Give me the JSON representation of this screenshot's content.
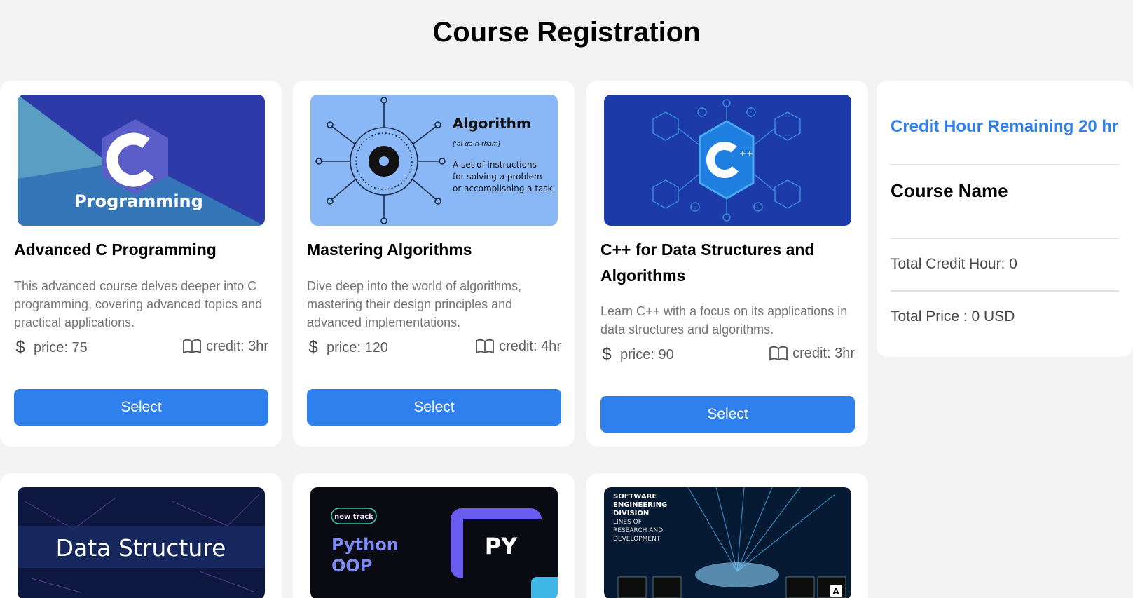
{
  "page": {
    "title": "Course Registration"
  },
  "courses": [
    {
      "title": "Advanced C Programming",
      "description": "This advanced course delves deeper into C programming, covering advanced topics and practical applications.",
      "price_label": "price: 75",
      "credit_label": "credit: 3hr",
      "select_label": "Select",
      "image_text": "Programming",
      "image_letter": "C"
    },
    {
      "title": "Mastering Algorithms",
      "description": "Dive deep into the world of algorithms, mastering their design principles and advanced implementations.",
      "price_label": "price: 120",
      "credit_label": "credit: 4hr",
      "select_label": "Select",
      "image_text": "Algorithm",
      "image_pron": "['al-ga-ri-tham]",
      "image_def": [
        "A set of instructions",
        "for solving a problem",
        "or accomplishing a task."
      ]
    },
    {
      "title": "C++ for Data Structures and Algorithms",
      "description": "Learn C++ with a focus on its applications in data structures and algorithms.",
      "price_label": "price: 90",
      "credit_label": "credit: 3hr",
      "select_label": "Select",
      "image_letter": "C",
      "image_plus": "++"
    },
    {
      "image_text": "Data Structure"
    },
    {
      "image_badge": "new track",
      "image_text": [
        "Python",
        "OOP"
      ],
      "image_code": "PY"
    },
    {
      "image_text": [
        "SOFTWARE",
        "ENGINEERING",
        "DIVISION",
        "LINES OF",
        "RESEARCH AND",
        "DEVELOPMENT"
      ],
      "image_badge": "A"
    }
  ],
  "icons": {
    "price": "dollar-icon",
    "credit": "book-open-icon"
  },
  "sidebar": {
    "credit_remaining": "Credit Hour Remaining 20 hr",
    "course_name_heading": "Course Name",
    "total_credit": "Total Credit Hour: 0",
    "total_price": "Total Price : 0 USD"
  },
  "colors": {
    "accent": "#2f80ed",
    "background": "#f3f3f3",
    "card": "#ffffff"
  }
}
